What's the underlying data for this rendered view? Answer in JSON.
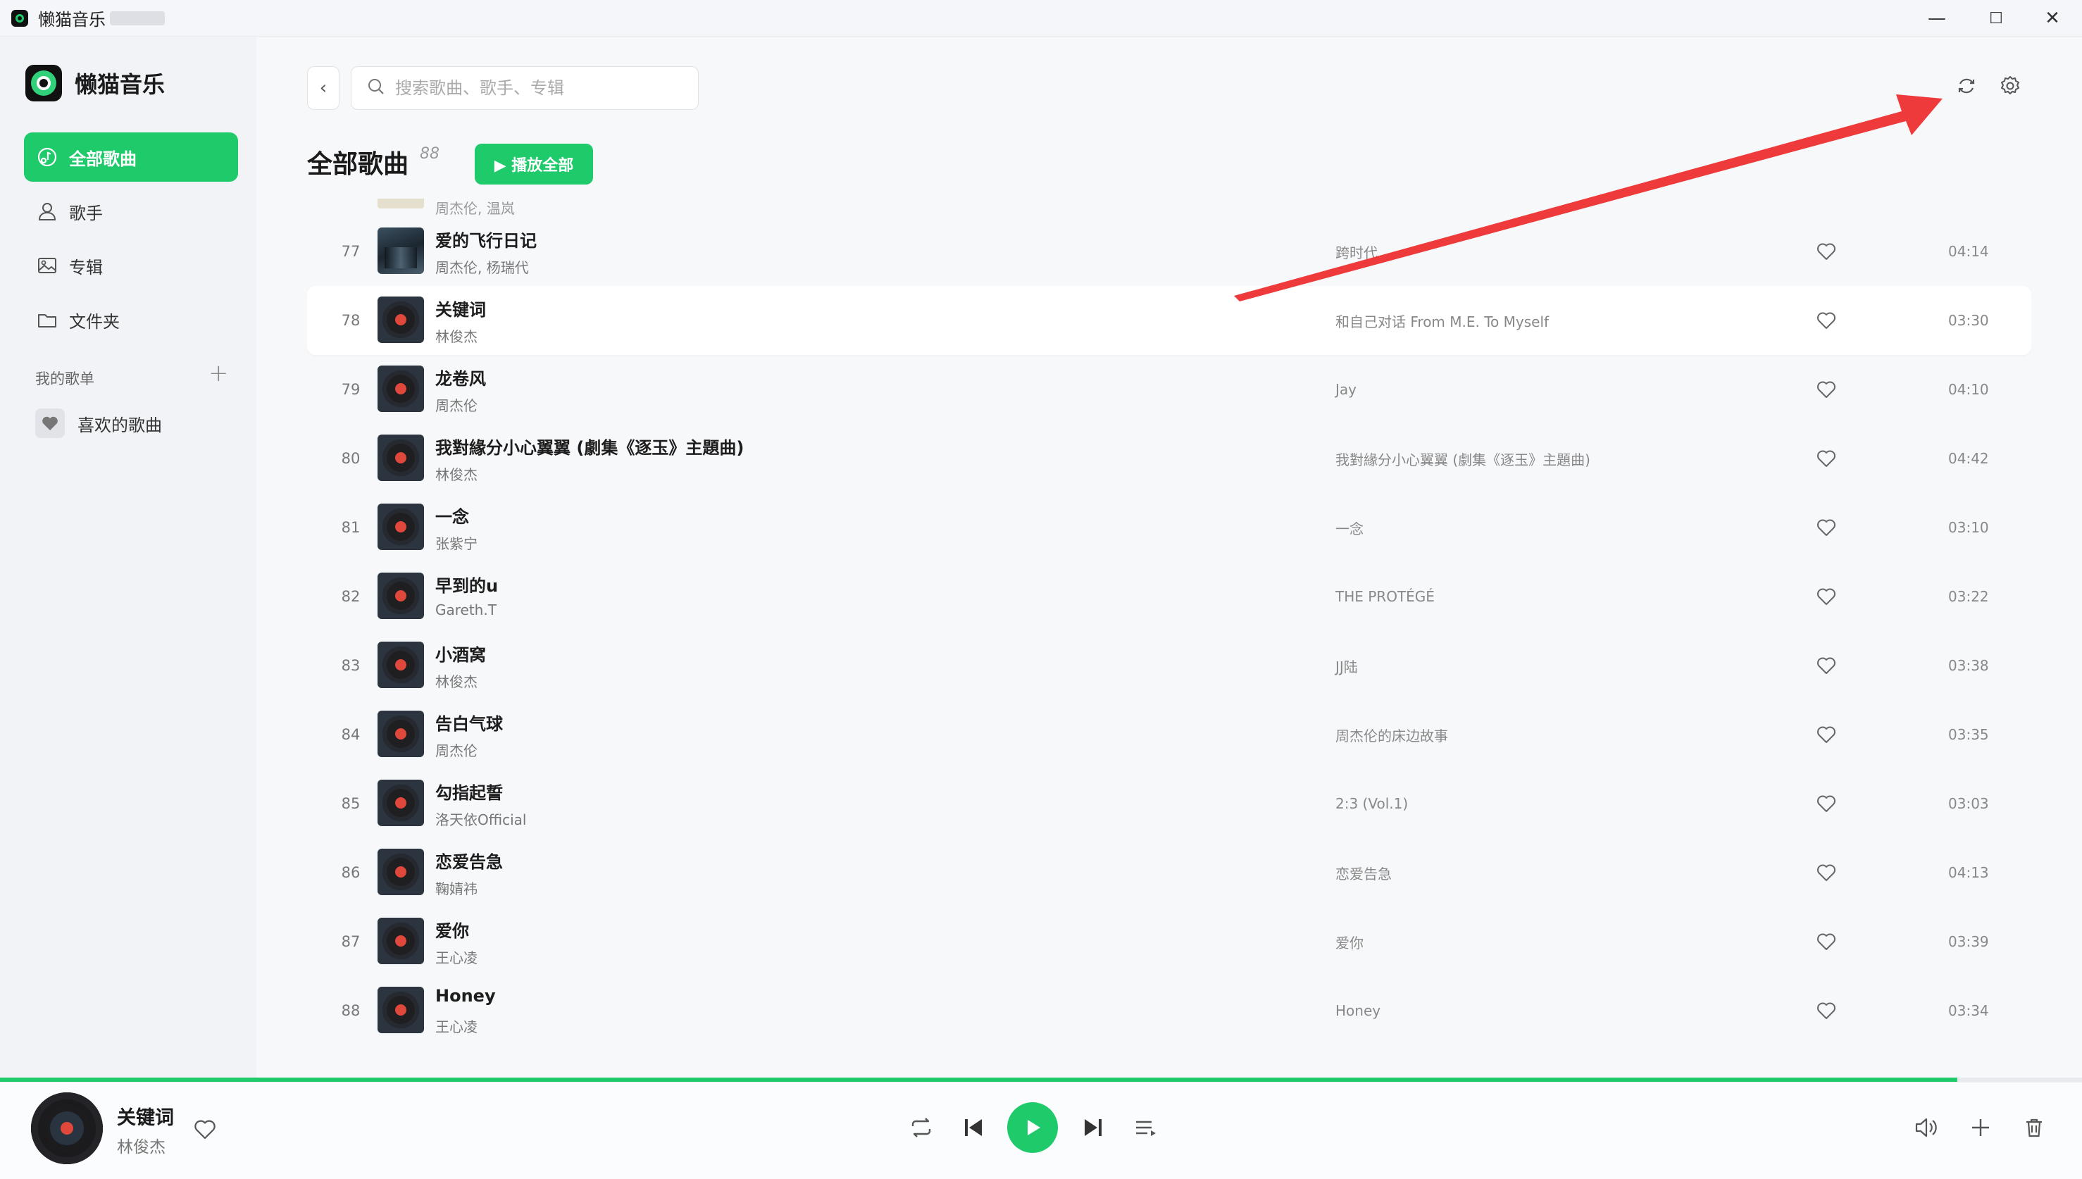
{
  "window": {
    "title": "懒猫音乐",
    "minimize_glyph": "—",
    "maximize_glyph": "☐",
    "close_glyph": "✕"
  },
  "sidebar": {
    "brand": "懒猫音乐",
    "nav": [
      {
        "label": "全部歌曲",
        "icon": "music-note-icon",
        "active": true
      },
      {
        "label": "歌手",
        "icon": "person-icon",
        "active": false
      },
      {
        "label": "专辑",
        "icon": "image-icon",
        "active": false
      },
      {
        "label": "文件夹",
        "icon": "folder-icon",
        "active": false
      }
    ],
    "my_playlists_label": "我的歌单",
    "add_glyph": "+",
    "favorites_label": "喜欢的歌曲"
  },
  "header": {
    "back_glyph": "‹",
    "search_placeholder": "搜索歌曲、歌手、专辑",
    "title": "全部歌曲",
    "count": "88",
    "play_all_label": "▶ 播放全部"
  },
  "songs": {
    "partial_prev_artist": "周杰伦, 温岚",
    "rows": [
      {
        "num": "77",
        "title": "爱的飞行日记",
        "artist": "周杰伦, 杨瑞代",
        "album": "跨时代",
        "duration": "04:14",
        "cover": "photo"
      },
      {
        "num": "78",
        "title": "关键词",
        "artist": "林俊杰",
        "album": "和自己对话 From M.E. To Myself",
        "duration": "03:30",
        "cover": "disc",
        "active": true
      },
      {
        "num": "79",
        "title": "龙卷风",
        "artist": "周杰伦",
        "album": "Jay",
        "duration": "04:10",
        "cover": "disc"
      },
      {
        "num": "80",
        "title": "我對緣分小心翼翼 (劇集《逐玉》主題曲)",
        "artist": "林俊杰",
        "album": "我對緣分小心翼翼 (劇集《逐玉》主題曲)",
        "duration": "04:42",
        "cover": "disc"
      },
      {
        "num": "81",
        "title": "一念",
        "artist": "张紫宁",
        "album": "一念",
        "duration": "03:10",
        "cover": "disc"
      },
      {
        "num": "82",
        "title": "早到的u",
        "artist": "Gareth.T",
        "album": "THE PROTÉGÉ",
        "duration": "03:22",
        "cover": "disc"
      },
      {
        "num": "83",
        "title": "小酒窝",
        "artist": "林俊杰",
        "album": "JJ陆",
        "duration": "03:38",
        "cover": "disc"
      },
      {
        "num": "84",
        "title": "告白气球",
        "artist": "周杰伦",
        "album": "周杰伦的床边故事",
        "duration": "03:35",
        "cover": "disc"
      },
      {
        "num": "85",
        "title": "勾指起誓",
        "artist": "洛天依Official",
        "album": "2:3 (Vol.1)",
        "duration": "03:03",
        "cover": "disc"
      },
      {
        "num": "86",
        "title": "恋爱告急",
        "artist": "鞠婧祎",
        "album": "恋爱告急",
        "duration": "04:13",
        "cover": "disc"
      },
      {
        "num": "87",
        "title": "爱你",
        "artist": "王心凌",
        "album": "爱你",
        "duration": "03:39",
        "cover": "disc"
      },
      {
        "num": "88",
        "title": "Honey",
        "artist": "王心凌",
        "album": "Honey",
        "duration": "03:34",
        "cover": "disc"
      }
    ]
  },
  "player": {
    "title": "关键词",
    "artist": "林俊杰",
    "progress": 0.94
  },
  "colors": {
    "accent": "#1fca6b",
    "annotation_arrow": "#ee3a3a"
  }
}
